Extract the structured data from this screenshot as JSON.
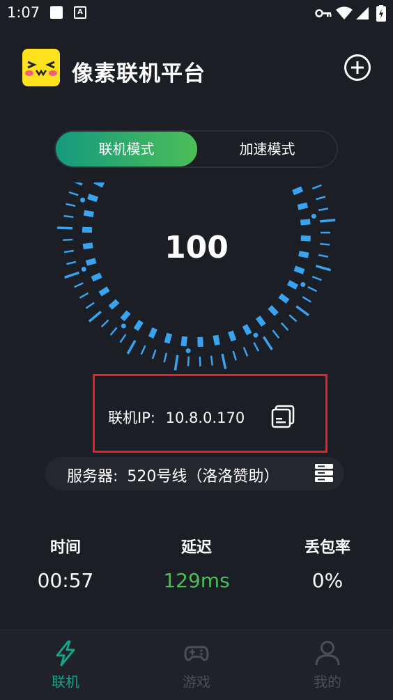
{
  "status_bar": {
    "time": "1:07",
    "notif_icon": "app-notification-icon"
  },
  "header": {
    "title": "像素联机平台"
  },
  "mode": {
    "tabs": [
      {
        "label": "联机模式",
        "active": true
      },
      {
        "label": "加速模式",
        "active": false
      }
    ]
  },
  "gauge": {
    "value": "100"
  },
  "connection": {
    "ip_label": "联机IP:",
    "ip": "10.8.0.170"
  },
  "server": {
    "label": "服务器:",
    "value": "520号线（洛洛赞助）"
  },
  "stats": [
    {
      "label": "时间",
      "value": "00:57"
    },
    {
      "label": "延迟",
      "value": "129ms",
      "color": "#4cbe58"
    },
    {
      "label": "丢包率",
      "value": "0%"
    }
  ],
  "nav": [
    {
      "label": "联机",
      "icon": "lightning-icon",
      "active": true,
      "color": "#1aa28a"
    },
    {
      "label": "游戏",
      "icon": "gamepad-icon",
      "active": false,
      "color": "#4a4e56"
    },
    {
      "label": "我的",
      "icon": "user-icon",
      "active": false,
      "color": "#4a4e56"
    }
  ],
  "colors": {
    "accent": "#1aa28a",
    "gauge": "#3aa3f0",
    "highlight": "#e8202a",
    "background": "#1b1e24"
  }
}
